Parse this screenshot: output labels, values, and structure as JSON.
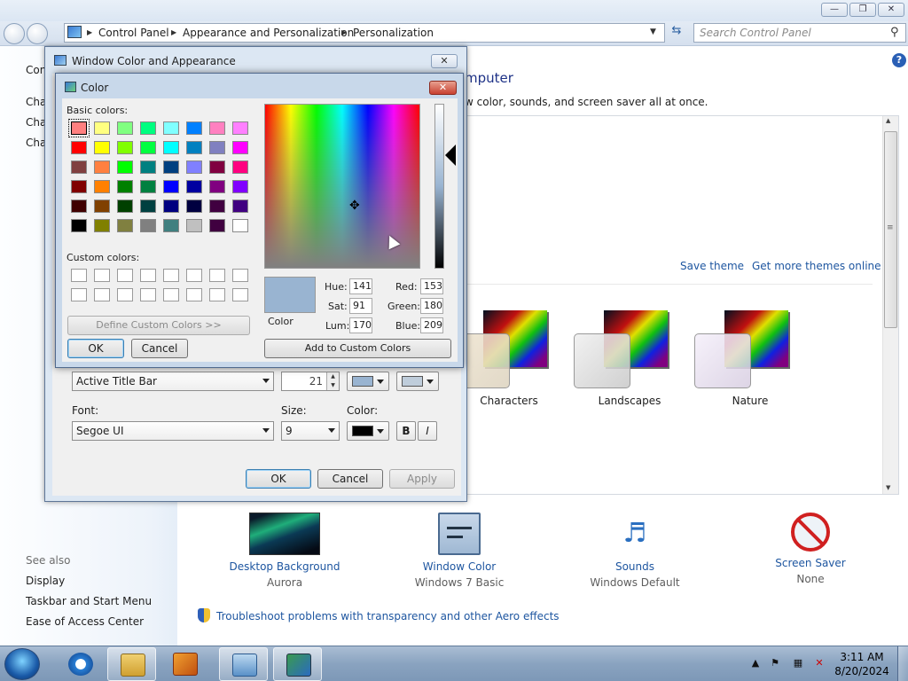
{
  "explorer": {
    "breadcrumb": [
      "Control Panel",
      "Appearance and Personalization",
      "Personalization"
    ],
    "search_placeholder": "Search Control Panel",
    "sidebar": {
      "top_fragment": "Con",
      "items": [
        "Cha",
        "Cha",
        "Cha"
      ],
      "see_also_label": "See also",
      "see_also": [
        "Display",
        "Taskbar and Start Menu",
        "Ease of Access Center"
      ]
    },
    "heading_fragment": "mputer",
    "description_fragment": "w color, sounds, and screen saver all at once.",
    "theme_links": {
      "save": "Save theme",
      "more": "Get more themes online"
    },
    "themes": [
      {
        "label": "Characters"
      },
      {
        "label": "Landscapes"
      },
      {
        "label": "Nature"
      }
    ],
    "bottom_tiles": [
      {
        "title": "Desktop Background",
        "subtitle": "Aurora",
        "icon": "aurora-thumbnail"
      },
      {
        "title": "Window Color",
        "subtitle": "Windows 7 Basic",
        "icon": "window-color-icon"
      },
      {
        "title": "Sounds",
        "subtitle": "Windows Default",
        "icon": "music-notes-icon"
      },
      {
        "title": "Screen Saver",
        "subtitle": "None",
        "icon": "no-screensaver-icon"
      }
    ],
    "troubleshoot_link": "Troubleshoot problems with transparency and other Aero effects"
  },
  "wca_dialog": {
    "title": "Window Color and Appearance",
    "item_value": "Active Title Bar",
    "size_value": "21",
    "color1": "#99b4d1",
    "color2": "#bfcddb",
    "font_label": "Font:",
    "font_value": "Segoe UI",
    "size_label": "Size:",
    "font_size_value": "9",
    "color_label": "Color:",
    "font_color": "#000000",
    "bold_label": "B",
    "italic_label": "I",
    "ok": "OK",
    "cancel": "Cancel",
    "apply": "Apply"
  },
  "color_dialog": {
    "title": "Color",
    "basic_colors_label": "Basic colors:",
    "basic_colors": [
      "#ff8080",
      "#ffff80",
      "#80ff80",
      "#00ff80",
      "#80ffff",
      "#0080ff",
      "#ff80c0",
      "#ff80ff",
      "#ff0000",
      "#ffff00",
      "#80ff00",
      "#00ff40",
      "#00ffff",
      "#0080c0",
      "#8080c0",
      "#ff00ff",
      "#804040",
      "#ff8040",
      "#00ff00",
      "#008080",
      "#004080",
      "#8080ff",
      "#800040",
      "#ff0080",
      "#800000",
      "#ff8000",
      "#008000",
      "#008040",
      "#0000ff",
      "#0000a0",
      "#800080",
      "#8000ff",
      "#400000",
      "#804000",
      "#004000",
      "#004040",
      "#000080",
      "#000040",
      "#400040",
      "#400080",
      "#000000",
      "#808000",
      "#808040",
      "#808080",
      "#408080",
      "#c0c0c0",
      "#400040",
      "#ffffff"
    ],
    "custom_colors_label": "Custom colors:",
    "define_custom": "Define Custom Colors >>",
    "ok": "OK",
    "cancel": "Cancel",
    "preview_label": "Color",
    "hue_label": "Hue:",
    "hue": "141",
    "sat_label": "Sat:",
    "sat": "91",
    "lum_label": "Lum:",
    "lum": "170",
    "red_label": "Red:",
    "red": "153",
    "green_label": "Green:",
    "green": "180",
    "blue_label": "Blue:",
    "blue": "209",
    "add_custom": "Add to Custom Colors",
    "preview_color": "#99b4d1"
  },
  "taskbar": {
    "time": "3:11 AM",
    "date": "8/20/2024",
    "apps": [
      "internet-explorer-icon",
      "windows-explorer-icon",
      "media-player-icon",
      "control-panel-icon",
      "personalization-icon"
    ]
  }
}
